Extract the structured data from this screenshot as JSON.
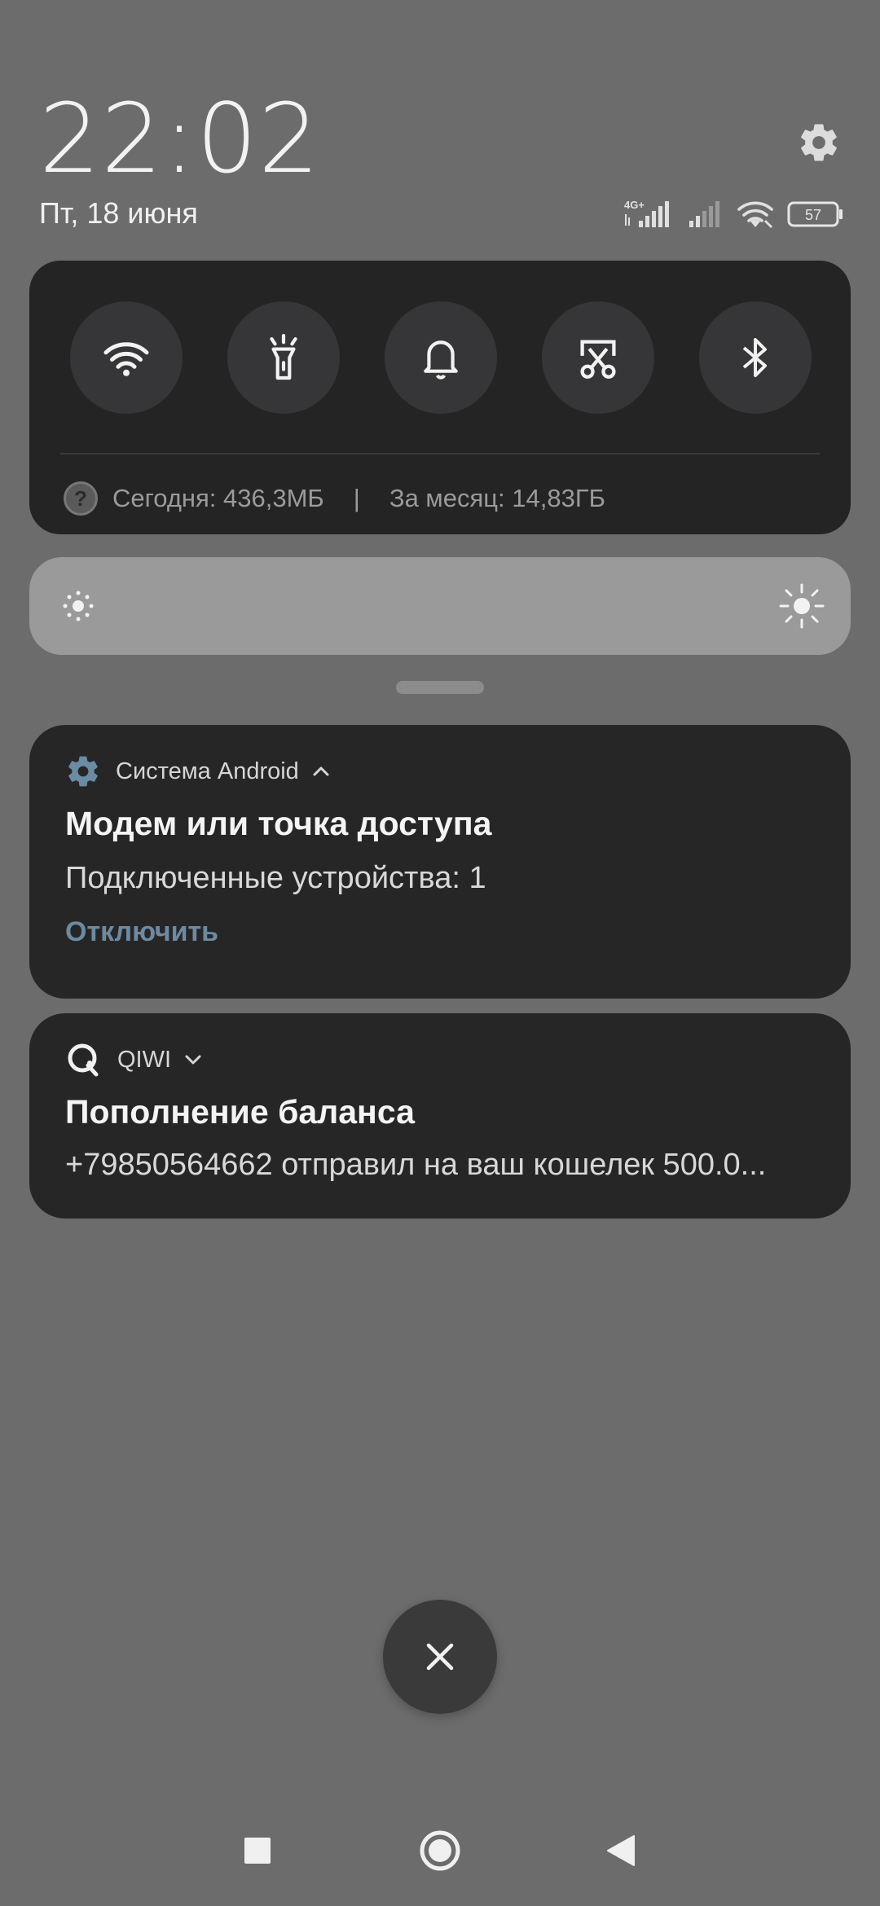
{
  "status": {
    "time": "22:02",
    "date": "Пт, 18 июня",
    "network_label": "4G+",
    "battery": "57"
  },
  "quick_settings": {
    "toggles": [
      {
        "icon": "wifi-icon"
      },
      {
        "icon": "flashlight-icon"
      },
      {
        "icon": "bell-icon"
      },
      {
        "icon": "screen-cast-icon"
      },
      {
        "icon": "bluetooth-icon"
      }
    ],
    "data_usage": {
      "help_glyph": "?",
      "today": "Сегодня: 436,3МБ",
      "separator": "|",
      "month": "За месяц: 14,83ГБ"
    }
  },
  "notifications": [
    {
      "app_name": "Система Android",
      "title": "Модем или точка доступа",
      "text": "Подключенные устройства: 1",
      "action": "Отключить"
    },
    {
      "app_name": "QIWI",
      "title": "Пополнение баланса",
      "text": "+79850564662 отправил на ваш кошелек 500.0..."
    }
  ],
  "colors": {
    "background": "#6c6c6c",
    "panel": "#242425",
    "accent": "#6d8aa1"
  }
}
